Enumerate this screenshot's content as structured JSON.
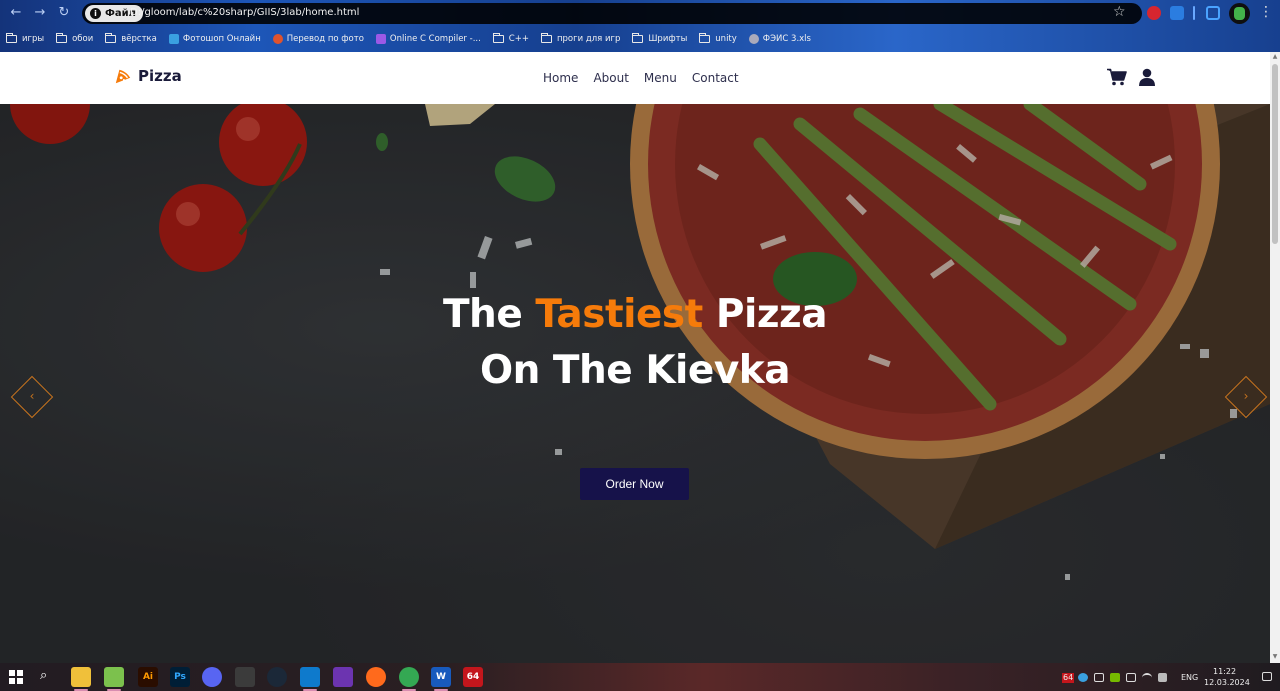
{
  "browser": {
    "file_chip": "Файл",
    "url": "D:/gloom/lab/c%20sharp/GIIS/3lab/home.html",
    "bookmarks": [
      {
        "label": "игры",
        "icon": "folder-icon"
      },
      {
        "label": "обои",
        "icon": "folder-icon"
      },
      {
        "label": "вёрстка",
        "icon": "folder-icon"
      },
      {
        "label": "Фотошоп Онлайн",
        "icon": "photoshop-online-icon"
      },
      {
        "label": "Перевод по фото",
        "icon": "translate-icon"
      },
      {
        "label": "Online C Compiler -...",
        "icon": "compiler-icon"
      },
      {
        "label": "C++",
        "icon": "folder-icon"
      },
      {
        "label": "проги для игр",
        "icon": "folder-icon"
      },
      {
        "label": "Шрифты",
        "icon": "folder-icon"
      },
      {
        "label": "unity",
        "icon": "folder-icon"
      },
      {
        "label": "ФЭИС 3.xls",
        "icon": "file-icon"
      }
    ]
  },
  "site": {
    "logo_text": "Pizza",
    "nav": [
      "Home",
      "About",
      "Menu",
      "Contact"
    ],
    "hero": {
      "title_part1": "The ",
      "title_accent": "Tastiest",
      "title_part2": " Pizza",
      "title_line2": "On The Kievka",
      "cta_label": "Order Now"
    },
    "arrow_left": "‹",
    "arrow_right": "›",
    "colors": {
      "accent": "#f67b0a",
      "button_bg": "#16124a",
      "header_text": "#1a1b3a"
    }
  },
  "taskbar": {
    "apps": [
      "file-explorer",
      "notepad++",
      "illustrator",
      "photoshop",
      "discord",
      "unknown-app",
      "steam",
      "vscode",
      "visual-studio",
      "firefox",
      "chrome",
      "word",
      "aida64"
    ],
    "illustrator_label": "Ai",
    "photoshop_label": "Ps",
    "word_label": "W",
    "aida_label": "64",
    "tray_badge": "64",
    "language": "ENG",
    "time": "11:22",
    "date": "12.03.2024"
  }
}
